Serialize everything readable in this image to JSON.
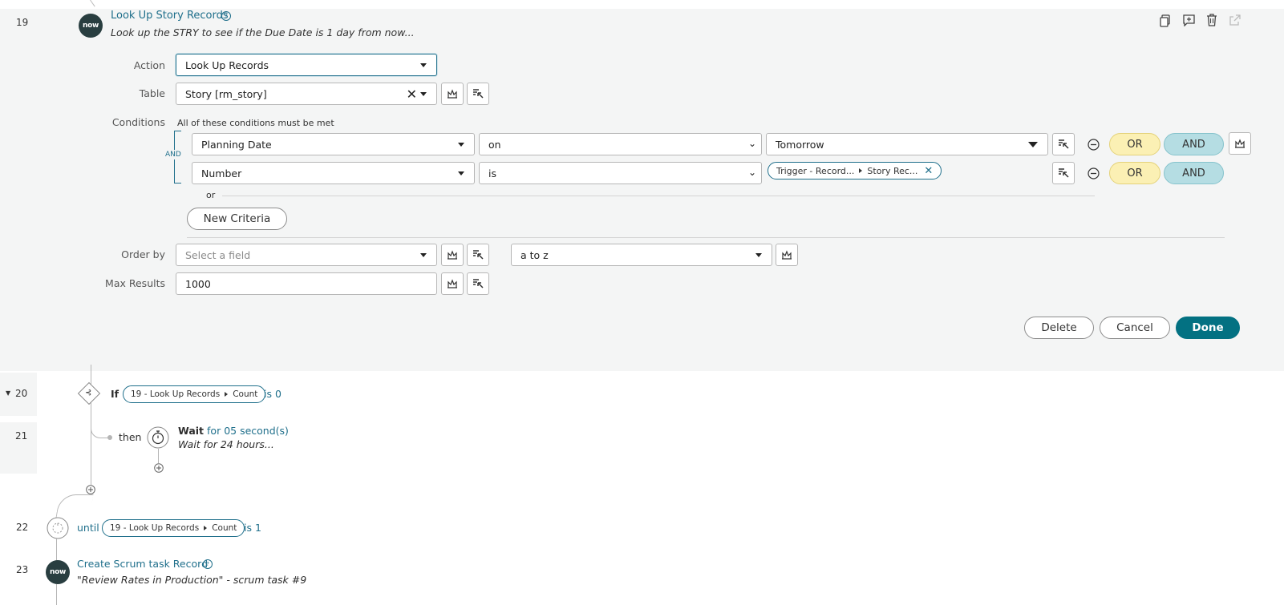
{
  "steps": {
    "s19": {
      "num": "19",
      "title": "Look Up Story Records",
      "desc": "Look up the STRY to see if the Due Date is 1 day from now..."
    },
    "s20": {
      "num": "20",
      "keyword": "If",
      "chip_left": "19 - Look Up Records",
      "chip_right": "Count",
      "suffix": "is 0"
    },
    "s21": {
      "num": "21",
      "then": "then",
      "title": "Wait",
      "title_suffix": "for 05 second(s)",
      "desc": "Wait for 24 hours..."
    },
    "s22": {
      "num": "22",
      "keyword": "until",
      "chip_left": "19 - Look Up Records",
      "chip_right": "Count",
      "suffix": "is 1"
    },
    "s23": {
      "num": "23",
      "title": "Create Scrum task Record",
      "desc": "\"Review Rates in Production\" - scrum task #9"
    }
  },
  "logo": "now",
  "form": {
    "action_label": "Action",
    "action_value": "Look Up Records",
    "table_label": "Table",
    "table_value": "Story [rm_story]",
    "conditions_label": "Conditions",
    "conditions_hint": "All of these conditions must be met",
    "and_label": "AND",
    "or_label": "or",
    "new_criteria": "New Criteria",
    "conditions": [
      {
        "field": "Planning Date",
        "operator": "on",
        "value": "Tomorrow"
      },
      {
        "field": "Number",
        "operator": "is",
        "value_chip_left": "Trigger - Record...",
        "value_chip_right": "Story Rec..."
      }
    ],
    "or_btn": "OR",
    "and_btn": "AND",
    "orderby_label": "Order by",
    "orderby_placeholder": "Select a field",
    "orderby_dir": "a to z",
    "maxresults_label": "Max Results",
    "maxresults_value": "1000"
  },
  "buttons": {
    "delete": "Delete",
    "cancel": "Cancel",
    "done": "Done"
  },
  "colors": {
    "accent": "#037182",
    "link": "#1f6f8b",
    "or_pill": "#fbf0b4",
    "and_pill": "#b5dde3",
    "panel_bg": "#f4f5f5"
  }
}
